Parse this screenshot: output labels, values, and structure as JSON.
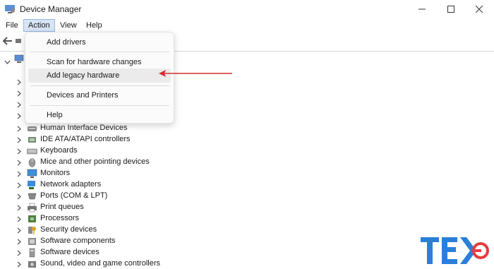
{
  "window": {
    "title": "Device Manager"
  },
  "menubar": {
    "file": "File",
    "action": "Action",
    "view": "View",
    "help": "Help"
  },
  "action_menu": {
    "items": [
      {
        "label": "Add drivers"
      },
      {
        "label": "Scan for hardware changes"
      },
      {
        "label": "Add legacy hardware",
        "highlighted": true
      },
      {
        "label": "Devices and Printers"
      },
      {
        "label": "Help"
      }
    ]
  },
  "tree": {
    "devices": [
      {
        "label": "Human Interface Devices",
        "icon": "hid-icon"
      },
      {
        "label": "IDE ATA/ATAPI controllers",
        "icon": "ide-controller-icon"
      },
      {
        "label": "Keyboards",
        "icon": "keyboard-icon"
      },
      {
        "label": "Mice and other pointing devices",
        "icon": "mouse-icon"
      },
      {
        "label": "Monitors",
        "icon": "monitor-icon"
      },
      {
        "label": "Network adapters",
        "icon": "network-adapter-icon"
      },
      {
        "label": "Ports (COM & LPT)",
        "icon": "port-icon"
      },
      {
        "label": "Print queues",
        "icon": "printer-icon"
      },
      {
        "label": "Processors",
        "icon": "processor-icon"
      },
      {
        "label": "Security devices",
        "icon": "security-device-icon"
      },
      {
        "label": "Software components",
        "icon": "software-component-icon"
      },
      {
        "label": "Software devices",
        "icon": "software-device-icon"
      },
      {
        "label": "Sound, video and game controllers",
        "icon": "sound-controller-icon"
      }
    ]
  },
  "colors": {
    "accent_arrow": "#d32f2f",
    "menu_highlight": "#d7e4f5",
    "logo_blue": "#2b7fd8",
    "logo_red": "#e43d3d"
  }
}
